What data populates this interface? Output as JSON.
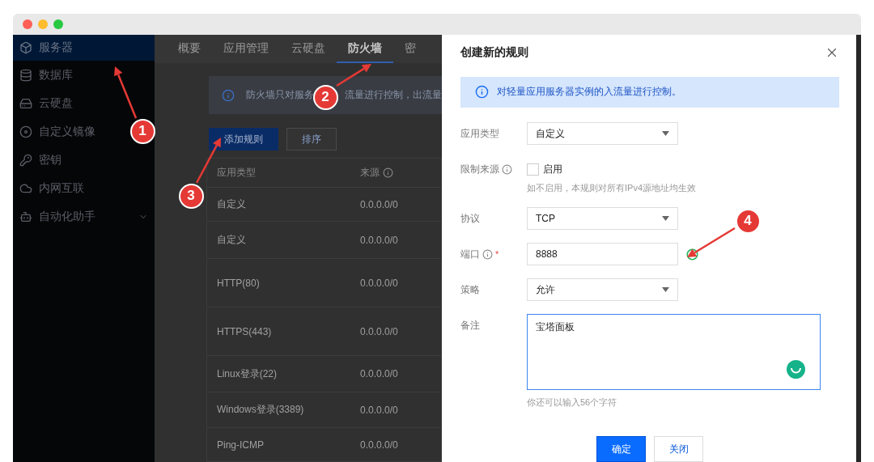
{
  "sidebar": {
    "items": [
      {
        "label": "服务器",
        "selected": true,
        "kind": "item"
      },
      {
        "label": "数据库",
        "selected": false,
        "kind": "item"
      },
      {
        "label": "云硬盘",
        "selected": false,
        "kind": "item"
      },
      {
        "label": "自定义镜像",
        "selected": false,
        "kind": "item"
      },
      {
        "label": "密钥",
        "selected": false,
        "kind": "item"
      },
      {
        "label": "内网互联",
        "selected": false,
        "kind": "item"
      },
      {
        "label": "自动化助手",
        "selected": false,
        "kind": "group"
      }
    ]
  },
  "tabs": [
    {
      "label": "概要",
      "selected": false
    },
    {
      "label": "应用管理",
      "selected": false
    },
    {
      "label": "云硬盘",
      "selected": false
    },
    {
      "label": "防火墙",
      "selected": true
    },
    {
      "label": "密",
      "selected": false
    }
  ],
  "notice": {
    "parts": [
      "防火墙只对服务",
      "流量进行控制，出流量"
    ]
  },
  "toolbar": [
    {
      "label": "添加规则",
      "kind": "primary"
    },
    {
      "label": "排序",
      "kind": "default"
    }
  ],
  "table": {
    "columns": [
      {
        "label": "应用类型",
        "info": false
      },
      {
        "label": "来源",
        "info": true
      }
    ],
    "rows": [
      {
        "cells": [
          "自定义",
          "0.0.0.0/0"
        ]
      },
      {
        "cells": [
          "自定义",
          "0.0.0.0/0"
        ]
      },
      {
        "cells": [
          "HTTP(80)",
          "0.0.0.0/0"
        ]
      },
      {
        "cells": [
          "HTTPS(443)",
          "0.0.0.0/0"
        ]
      },
      {
        "cells": [
          "Linux登录(22)",
          "0.0.0.0/0"
        ]
      },
      {
        "cells": [
          "Windows登录(3389)",
          "0.0.0.0/0"
        ]
      },
      {
        "cells": [
          "Ping-ICMP",
          "0.0.0.0/0"
        ]
      }
    ]
  },
  "dialog": {
    "title": "创建新的规则",
    "notice": "对轻量应用服务器实例的入流量进行控制。",
    "fields": [
      {
        "kind": "select",
        "label": "应用类型",
        "info": false,
        "value": "自定义"
      },
      {
        "kind": "checkbox",
        "label": "限制来源",
        "info": true,
        "checked": false,
        "option": "启用",
        "hint": "如不启用，本规则对所有IPv4源地址均生效"
      },
      {
        "kind": "select",
        "label": "协议",
        "info": false,
        "value": "TCP"
      },
      {
        "kind": "input",
        "label": "端口",
        "info": true,
        "required_mark": "*",
        "value": "8888",
        "valid": true
      },
      {
        "kind": "select",
        "label": "策略",
        "info": false,
        "value": "允许"
      },
      {
        "kind": "textarea",
        "label": "备注",
        "info": false,
        "value": "宝塔面板",
        "hint": "你还可以输入56个字符"
      }
    ],
    "actions": [
      {
        "label": "确定",
        "kind": "primary"
      },
      {
        "label": "关闭",
        "kind": "default"
      }
    ]
  },
  "annotations": [
    {
      "label": "1"
    },
    {
      "label": "2"
    },
    {
      "label": "3"
    },
    {
      "label": "4"
    }
  ]
}
